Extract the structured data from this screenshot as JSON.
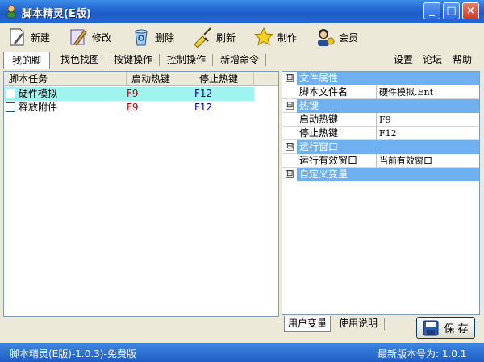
{
  "window": {
    "title": "脚本精灵(E版)",
    "controls": {
      "minimize": "_",
      "maximize": "□",
      "close": "×"
    }
  },
  "toolbar": {
    "new_label": "新建",
    "edit_label": "修改",
    "delete_label": "删除",
    "refresh_label": "刷新",
    "make_label": "制作",
    "member_label": "会员"
  },
  "tabs": {
    "my_scripts": "我的脚本",
    "color_pick": "找色找图",
    "key_ops": "按键操作",
    "control_ops": "控制操作",
    "new_cmd": "新增命令"
  },
  "top_links": {
    "settings": "设置",
    "forum": "论坛",
    "help": "帮助"
  },
  "script_list": {
    "columns": [
      "脚本任务",
      "启动热键",
      "停止热键"
    ],
    "rows": [
      {
        "name": "硬件模拟",
        "start": "F9",
        "stop": "F12",
        "selected": true
      },
      {
        "name": "释放附件",
        "start": "F9",
        "stop": "F12",
        "selected": false
      }
    ]
  },
  "properties": {
    "file_category": "文件属性",
    "file_name_key": "脚本文件名",
    "file_name_value": "硬件模拟.Ent",
    "hotkey_category": "热键",
    "start_key": "启动热键",
    "start_value": "F9",
    "stop_key": "停止热键",
    "stop_value": "F12",
    "window_category": "运行窗口",
    "window_key": "运行有效窗口",
    "window_value": "当前有效窗口",
    "var_category": "自定义变量",
    "expander_symbol": "⊟"
  },
  "bottom_tabs": {
    "user_vars": "用户变量",
    "usage": "使用说明"
  },
  "save_label": "保 存",
  "status": {
    "left": "脚本精灵(E版)-1.0.3)-免费版",
    "right": "最新版本号为: 1.0.1"
  },
  "colors": {
    "title_bar": "#2a6fd6",
    "selection": "#a0f4f0",
    "category": "#6eb0f0",
    "hotkey_start": "#c00000",
    "hotkey_stop": "#00008b"
  }
}
